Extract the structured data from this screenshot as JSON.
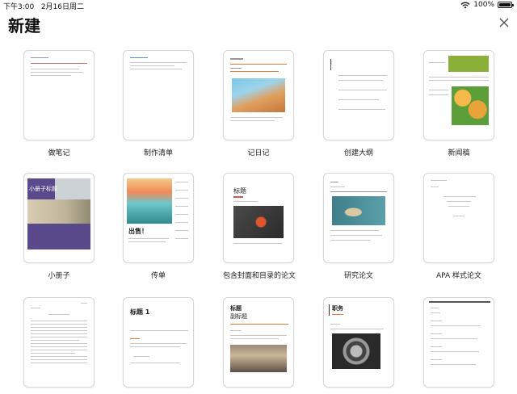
{
  "status": {
    "time": "下午3:00",
    "date": "2月16日周二",
    "battery": "100%"
  },
  "page_title": "新建",
  "templates": [
    {
      "label": "做笔记"
    },
    {
      "label": "制作清单"
    },
    {
      "label": "记日记"
    },
    {
      "label": "创建大纲"
    },
    {
      "label": "新闻稿"
    },
    {
      "label": "小册子"
    },
    {
      "label": "传单"
    },
    {
      "label": "包含封面和目录的论文"
    },
    {
      "label": "研究论文"
    },
    {
      "label": "APA 样式论文"
    },
    {
      "label": ""
    },
    {
      "label": ""
    },
    {
      "label": ""
    },
    {
      "label": ""
    },
    {
      "label": ""
    }
  ],
  "thumb_text": {
    "brochure_title": "小册子标题",
    "flyer_title": "出售！",
    "essay_heading": "标题",
    "outline_num": "I",
    "report_title": "标题 1",
    "memo_title": "标题",
    "memo_subtitle": "副标题",
    "job_title": "职务"
  },
  "colors": {
    "accent_orange": "#e07b39",
    "brochure_purple": "#5b4a8b",
    "news_green": "#8bb03a",
    "essay_red": "#d9534f"
  }
}
